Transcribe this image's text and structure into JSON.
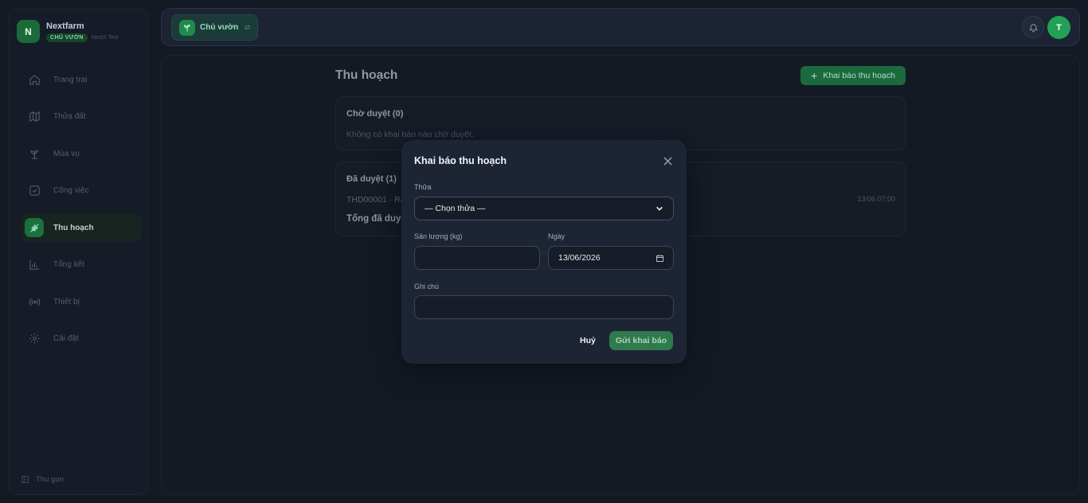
{
  "brand": {
    "initial": "N",
    "name": "Nextfarm",
    "role_badge": "CHỦ VƯỜN",
    "tenant": "NextX Test"
  },
  "sidebar": {
    "items": [
      {
        "label": "Trang trại",
        "icon": "home-icon",
        "active": false
      },
      {
        "label": "Thửa đất",
        "icon": "map-icon",
        "active": false
      },
      {
        "label": "Mùa vụ",
        "icon": "sprout-icon",
        "active": false
      },
      {
        "label": "Công việc",
        "icon": "checkbox-icon",
        "active": false
      },
      {
        "label": "Thu hoạch",
        "icon": "wheat-icon",
        "active": true
      },
      {
        "label": "Tổng kết",
        "icon": "bar-chart-icon",
        "active": false
      },
      {
        "label": "Thiết bị",
        "icon": "radio-icon",
        "active": false
      },
      {
        "label": "Cài đặt",
        "icon": "gear-icon",
        "active": false
      }
    ],
    "collapse_label": "Thu gọn"
  },
  "topbar": {
    "role_switch_label": "Chủ vườn",
    "user_initial": "T"
  },
  "page": {
    "title": "Thu hoạch",
    "add_button_label": "Khai báo thu hoạch",
    "pending": {
      "title": "Chờ duyệt (0)",
      "empty_text": "Không có khai báo nào chờ duyệt."
    },
    "approved": {
      "title": "Đã duyệt (1)",
      "record_code": "THD00001 · Ra",
      "record_time": "13/06 07:00",
      "total_label": "Tổng đã duyệt"
    }
  },
  "modal": {
    "title": "Khai báo thu hoạch",
    "plot_label": "Thửa",
    "plot_selected": "— Chọn thửa —",
    "quantity_label": "Sản lượng (kg)",
    "quantity_value": "",
    "date_label": "Ngày",
    "date_value": "13/06/2026",
    "note_label": "Ghi chú",
    "note_value": "",
    "cancel_label": "Huỷ",
    "submit_label": "Gửi khai báo"
  },
  "colors": {
    "accent": "#1f8a4a",
    "background": "#141a24",
    "modal": "#1d2535"
  }
}
